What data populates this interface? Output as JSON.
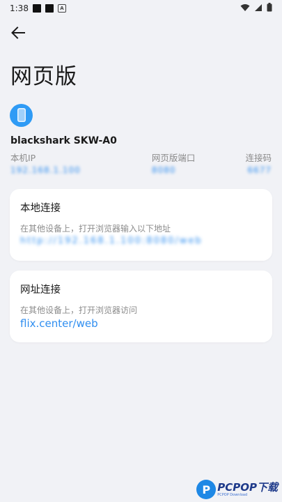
{
  "status_bar": {
    "time": "1:38",
    "notif_icons": [
      "square-icon",
      "square-icon",
      "a-icon"
    ],
    "right_icons": [
      "wifi-icon",
      "signal-icon",
      "battery-icon"
    ]
  },
  "header": {
    "title": "网页版"
  },
  "device": {
    "name": "blackshark SKW-A0",
    "icon_color": "#2f9bf5"
  },
  "info": [
    {
      "label": "本机IP",
      "value": "192.168.1.100"
    },
    {
      "label": "网页版端口",
      "value": "8080"
    },
    {
      "label": "连接码",
      "value": "6677"
    }
  ],
  "cards": [
    {
      "title": "本地连接",
      "desc": "在其他设备上，打开浏览器输入以下地址",
      "link": "http://192.168.1.100:8080/web"
    },
    {
      "title": "网址连接",
      "desc": "在其他设备上，打开浏览器访问",
      "link": "flix.center/web"
    }
  ],
  "watermark": {
    "logo_letter": "P",
    "text": "PCPOP下载",
    "sub": "PCPOP Download"
  },
  "colors": {
    "accent": "#2f8ef0",
    "background": "#f1f2f6",
    "card": "#ffffff",
    "muted": "#8c8c8c"
  }
}
